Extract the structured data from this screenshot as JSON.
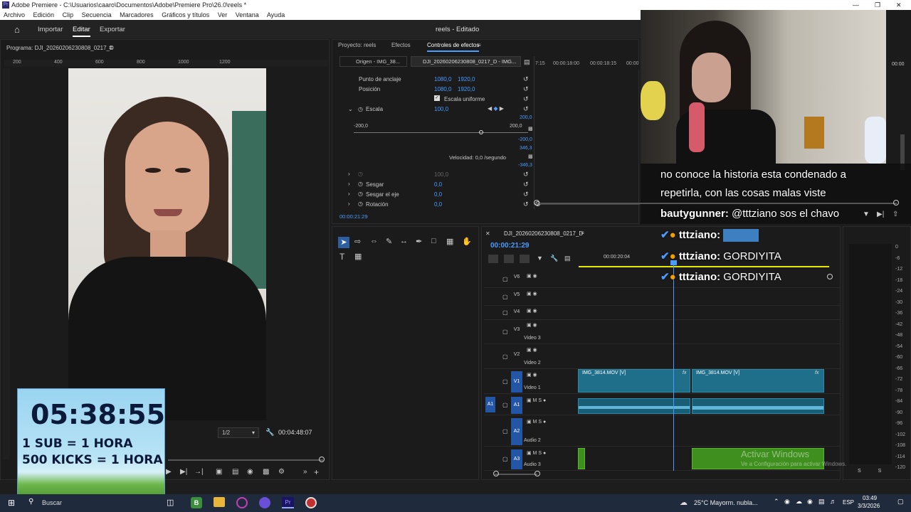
{
  "window": {
    "title": "Adobe Premiere - C:\\Usuarios\\caaro\\Documentos\\Adobe\\Premiere Pro\\26.0\\reels *"
  },
  "menu": [
    "Archivo",
    "Edición",
    "Clip",
    "Secuencia",
    "Marcadores",
    "Gráficos y títulos",
    "Ver",
    "Ventana",
    "Ayuda"
  ],
  "appbar": {
    "import": "Importar",
    "edit": "Editar",
    "export": "Exportar",
    "project_title": "reels - Editado"
  },
  "program": {
    "title": "Programa: DJI_20260206230808_0217_D",
    "ruler": [
      "200",
      "400",
      "600",
      "800",
      "1000",
      "1200"
    ],
    "zoom": "1/2",
    "duration": "00:04:48:07"
  },
  "top_panel": {
    "tabs": [
      "Proyecto: reels",
      "Efectos",
      "Controles de efectos"
    ],
    "source_tab": "Origen - IMG_38...",
    "seq_tab": "DJI_20260206230808_0217_D - IMG...",
    "rows": [
      {
        "label": "Punto de anclaje",
        "v1": "1080,0",
        "v2": "1920,0"
      },
      {
        "label": "Posición",
        "v1": "1080,0",
        "v2": "1920,0"
      },
      {
        "label": "Escala uniforme",
        "v1": "",
        "v2": ""
      },
      {
        "label": "Escala",
        "v1": "100,0",
        "v2": ""
      }
    ],
    "slider_min": "-200,0",
    "slider_max": "200,0",
    "top_val": "200,0",
    "neg_val": "-200,0",
    "v_a": "346,3",
    "v_b": "-346,3",
    "velocity": "Velocidad: 0,0 /segundo",
    "rows2": [
      {
        "label": "",
        "v1": "100,0"
      },
      {
        "label": "Sesgar",
        "v1": "0,0"
      },
      {
        "label": "Sesgar el eje",
        "v1": "0,0"
      },
      {
        "label": "Rotación",
        "v1": "0,0"
      }
    ],
    "timecode": "00:00:21:29",
    "ruler": [
      "7:15",
      "00:00:18:00",
      "00:00:18:15",
      "00:00"
    ],
    "ruler_end": "00:00"
  },
  "timeline": {
    "title": "DJI_20260206230808_0217_D",
    "timecode": "00:00:21:29",
    "ruler_time": "00:00:20:04",
    "tracks": [
      {
        "id": "V6",
        "name": ""
      },
      {
        "id": "V5",
        "name": ""
      },
      {
        "id": "V4",
        "name": ""
      },
      {
        "id": "V3",
        "name": "Video 3"
      },
      {
        "id": "V2",
        "name": "Video 2"
      },
      {
        "id": "V1",
        "name": "Video 1"
      },
      {
        "id": "A1",
        "name": ""
      },
      {
        "id": "A2",
        "name": "Audio 2"
      },
      {
        "id": "A3",
        "name": "Audio 3"
      }
    ],
    "clip1": "IMG_3814.MOV [V]",
    "clip2": "IMG_3814.MOV [V]",
    "src_v": "V1",
    "src_a": "A1"
  },
  "meter": {
    "ticks": [
      "0",
      "-6",
      "-12",
      "-18",
      "-24",
      "-30",
      "-36",
      "-42",
      "-48",
      "-54",
      "-60",
      "-66",
      "-72",
      "-78",
      "-84",
      "-90",
      "-96",
      "-102",
      "-108",
      "-114",
      "-120"
    ],
    "foot": "S S"
  },
  "chat": [
    {
      "user": "",
      "text": "no conoce la historia esta condenado a"
    },
    {
      "user": "",
      "text": "repetirla, con las cosas malas viste"
    },
    {
      "user": "bautygunner:",
      "text": " @tttziano sos el chavo"
    },
    {
      "user": "tttziano:",
      "text": ""
    },
    {
      "user": "tttziano:",
      "text": " GORDIYITA"
    },
    {
      "user": "tttziano:",
      "text": " GORDIYITA"
    }
  ],
  "overlay": {
    "timer": "05:38:55",
    "line1": "1 SUB = 1 HORA",
    "line2": "500 KICKS = 1 HORA"
  },
  "watermark": {
    "line1": "Activar Windows",
    "line2": "Ve a Configuración para activar Windows."
  },
  "taskbar": {
    "search": "Buscar",
    "weather": "25°C  Mayorm. nubla...",
    "lang": "ESP",
    "time": "03:49",
    "date": "3/3/2026"
  },
  "colors": {
    "accent": "#4a9cff",
    "clip": "#1f6f8b",
    "audio": "#1a5e75",
    "green": "#3f8f1e",
    "playhead": "#4a9cff"
  }
}
